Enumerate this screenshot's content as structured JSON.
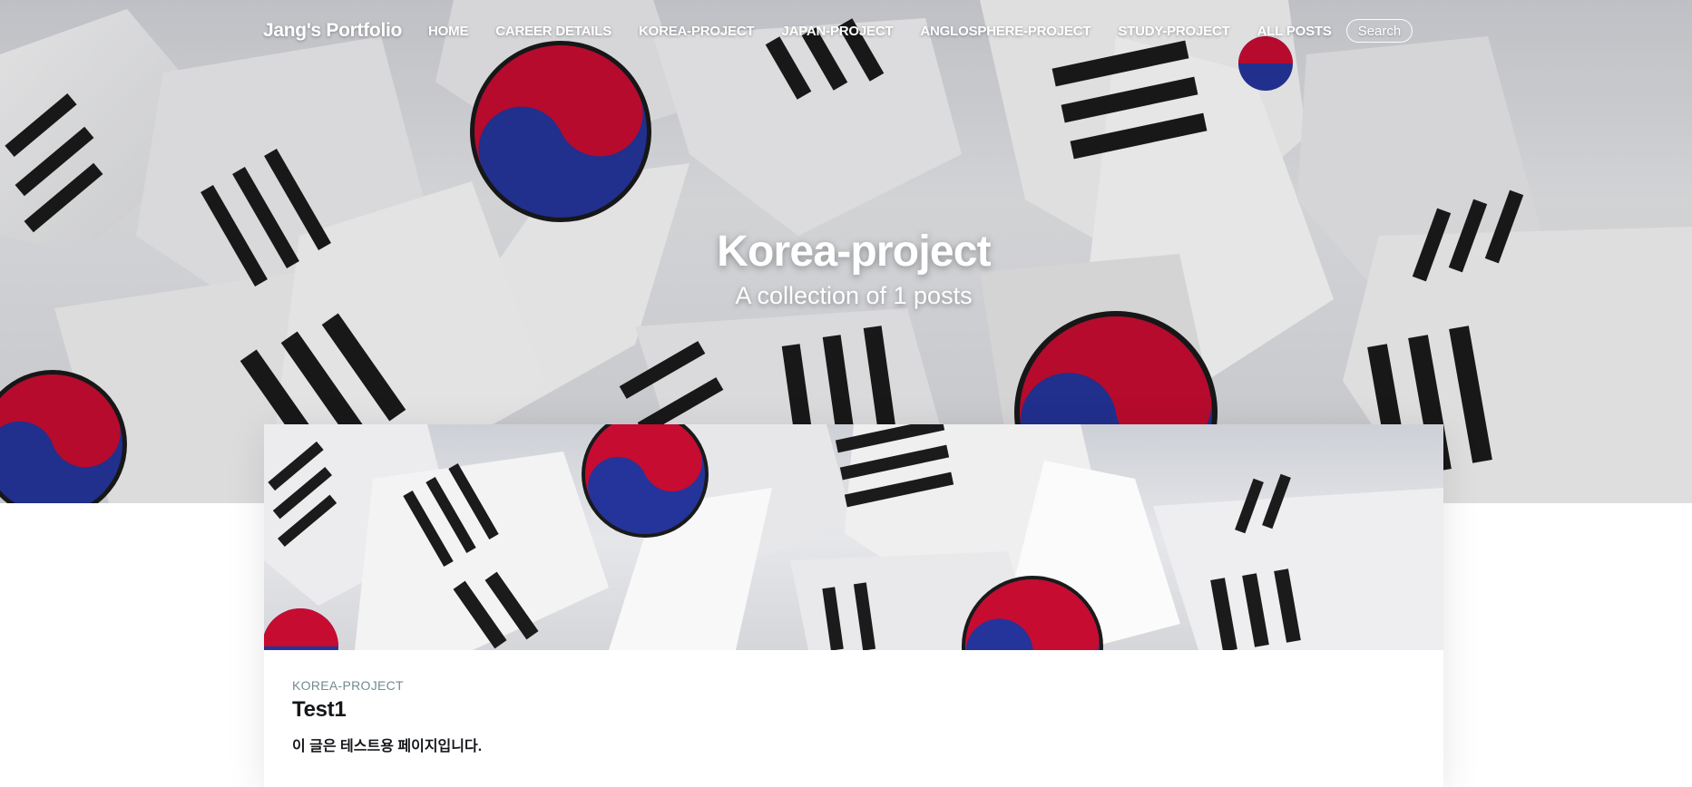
{
  "site": {
    "brand": "Jang's Portfolio",
    "nav": [
      {
        "label": "HOME"
      },
      {
        "label": "CAREER DETAILS"
      },
      {
        "label": "KOREA-PROJECT"
      },
      {
        "label": "JAPAN-PROJECT"
      },
      {
        "label": "ANGLOSPHERE-PROJECT"
      },
      {
        "label": "STUDY-PROJECT"
      },
      {
        "label": "ALL POSTS"
      }
    ],
    "search": {
      "label": "Search",
      "icon": "search-icon"
    }
  },
  "hero": {
    "title": "Korea-project",
    "subtitle": "A collection of 1 posts"
  },
  "posts": [
    {
      "tag": "KOREA-PROJECT",
      "title": "Test1",
      "excerpt": "이 글은 테스트용 페이지입니다."
    }
  ],
  "colors": {
    "flag_red": "#c60c30",
    "flag_blue": "#24349a",
    "trigram_black": "#1b1b1b",
    "tag_gray": "#738a94",
    "text_dark": "#15171a"
  }
}
